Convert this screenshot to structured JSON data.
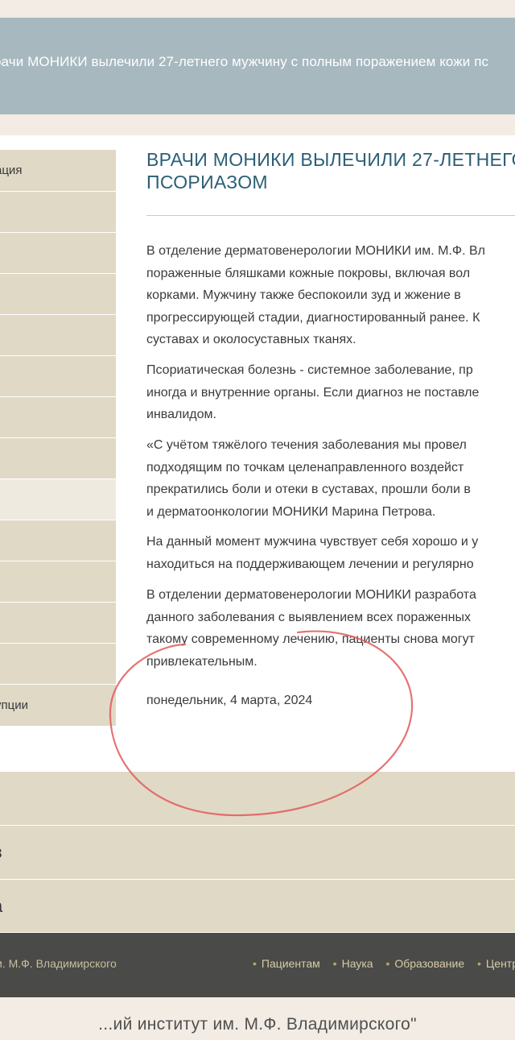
{
  "banner": {
    "text": "рачи МОНИКИ вылечили 27-летнего мужчину с полным поражением кожи пс"
  },
  "sidebar": {
    "items": [
      {
        "label": "ация"
      },
      {
        "label": ""
      },
      {
        "label": ""
      },
      {
        "label": ""
      },
      {
        "label": ""
      },
      {
        "label": ""
      },
      {
        "label": ""
      },
      {
        "label": ""
      },
      {
        "label": ""
      },
      {
        "label": ""
      },
      {
        "label": ""
      },
      {
        "label": ""
      },
      {
        "label": ""
      },
      {
        "label": "упции"
      }
    ]
  },
  "article": {
    "title_lines": [
      "ВРАЧИ МОНИКИ ВЫЛЕЧИЛИ 27-ЛЕТНЕГО",
      "ПСОРИАЗОМ"
    ],
    "paragraphs": [
      [
        "В отделение дерматовенерологии МОНИКИ им. М.Ф. Вл",
        "пораженные бляшками кожные покровы, включая вол",
        "корками. Мужчину также беспокоили зуд и жжение в",
        "прогрессирующей стадии, диагностированный ранее. К",
        "суставах и околосуставных тканях."
      ],
      [
        "Псориатическая болезнь - системное заболевание, пр",
        "иногда и внутренние органы. Если диагноз не поставле",
        "инвалидом."
      ],
      [
        "«С учётом тяжёлого течения заболевания мы провел",
        "подходящим по точкам целенаправленного воздейст",
        "прекратились боли и отеки в суставах, прошли боли в",
        "и дерматоонкологии МОНИКИ Марина Петрова."
      ],
      [
        "На данный момент мужчина чувствует себя хорошо и у",
        "находиться на поддерживающем лечении и регулярно"
      ],
      [
        "В отделении дерматовенерологии МОНИКИ разработа",
        "данного заболевания с выявлением всех пораженных",
        "такому современному лечению, пациенты снова могут",
        "привлекательным."
      ]
    ],
    "date": "понедельник, 4 марта, 2024"
  },
  "accordion": {
    "rows": [
      {
        "label": ""
      },
      {
        "label": "в"
      },
      {
        "label": "а"
      }
    ]
  },
  "footer": {
    "left_text": "и. М.Ф. Владимирского",
    "nav": [
      "Пациентам",
      "Наука",
      "Образование",
      "Центр"
    ]
  },
  "bottom": {
    "title": "...ий институт им. М.Ф. Владимирского\""
  },
  "colors": {
    "banner": "#a7b8bf",
    "sidebar": "#e0d9c6",
    "title": "#2b5f75",
    "footer": "#4a4a48",
    "annotation": "#e05a5a"
  }
}
